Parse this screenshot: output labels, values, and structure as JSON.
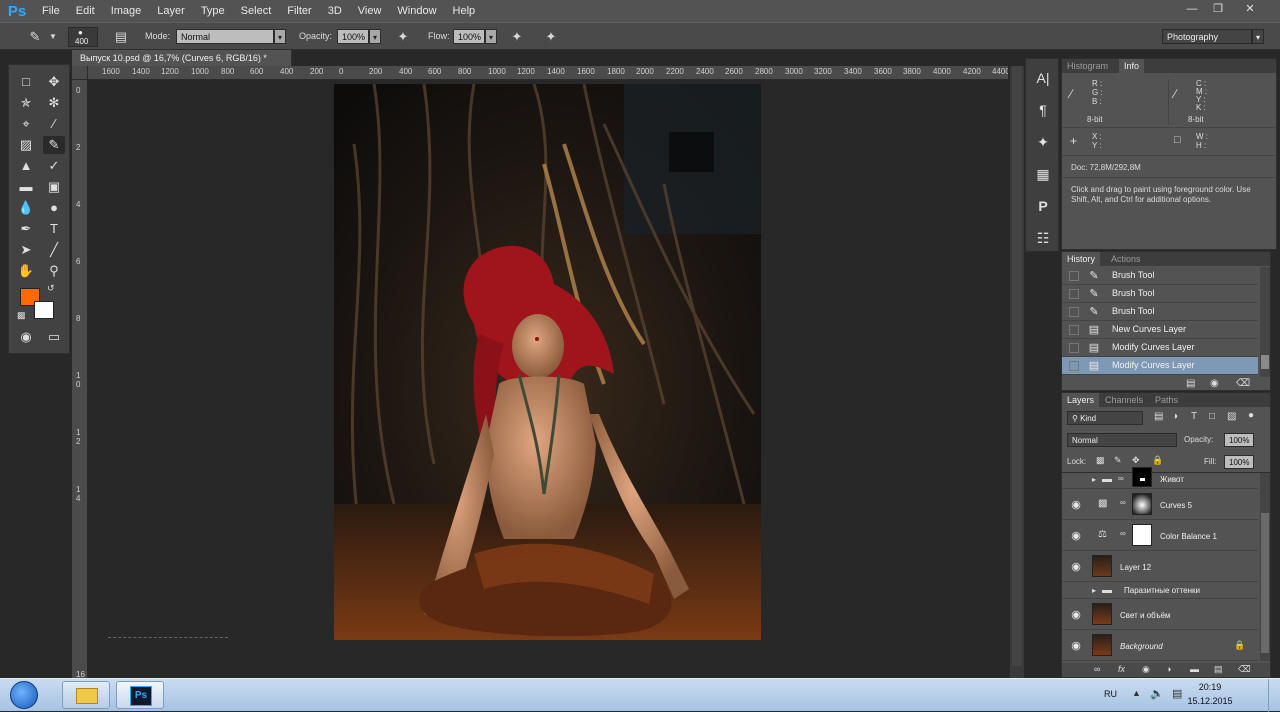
{
  "app": {
    "logo": "Ps",
    "menu": [
      "File",
      "Edit",
      "Image",
      "Layer",
      "Type",
      "Select",
      "Filter",
      "3D",
      "View",
      "Window",
      "Help"
    ]
  },
  "options": {
    "brush_size": "400",
    "mode_label": "Mode:",
    "mode_value": "Normal",
    "opacity_label": "Opacity:",
    "opacity_value": "100%",
    "flow_label": "Flow:",
    "flow_value": "100%",
    "workspace": "Photography"
  },
  "document": {
    "tab_title": "Выпуск 10.psd @ 16,7% (Curves 6, RGB/16) *",
    "ruler_h": [
      "1600",
      "1400",
      "1200",
      "1000",
      "800",
      "600",
      "400",
      "200",
      "0",
      "200",
      "400",
      "600",
      "800",
      "1000",
      "1200",
      "1400",
      "1600",
      "1800",
      "2000",
      "2200",
      "2400",
      "2600",
      "2800",
      "3000",
      "3200",
      "3400",
      "3600",
      "3800",
      "4000",
      "4200",
      "4400"
    ],
    "ruler_v": [
      "0",
      "2",
      "4",
      "6",
      "8",
      "1 0",
      "1 2",
      "1 4"
    ],
    "ruler_v_bottom": "16"
  },
  "info_panel": {
    "tabs": [
      "Histogram",
      "Info"
    ],
    "rgb_labels": [
      "R :",
      "G :",
      "B :"
    ],
    "cmyk_labels": [
      "C :",
      "M :",
      "Y :",
      "K :"
    ],
    "bit_left": "8-bit",
    "bit_right": "8-bit",
    "xy_labels": [
      "X :",
      "Y :"
    ],
    "wh_labels": [
      "W :",
      "H :"
    ],
    "doc_size": "Doc: 72,8M/292,8M",
    "hint": "Click and drag to paint using foreground color. Use Shift, Alt, and Ctrl for additional options."
  },
  "history_panel": {
    "tabs": [
      "History",
      "Actions"
    ],
    "items": [
      {
        "label": "Brush Tool",
        "icon": "brush-icon"
      },
      {
        "label": "Brush Tool",
        "icon": "brush-icon"
      },
      {
        "label": "Brush Tool",
        "icon": "brush-icon"
      },
      {
        "label": "New Curves Layer",
        "icon": "layer-state-icon"
      },
      {
        "label": "Modify Curves Layer",
        "icon": "layer-state-icon"
      },
      {
        "label": "Modify Curves Layer",
        "icon": "layer-state-icon"
      }
    ]
  },
  "layers_panel": {
    "tabs": [
      "Layers",
      "Channels",
      "Paths"
    ],
    "filter_kind": "Kind",
    "blend_mode": "Normal",
    "opacity_label": "Opacity:",
    "opacity_value": "100%",
    "lock_label": "Lock:",
    "fill_label": "Fill:",
    "fill_value": "100%",
    "layers": [
      {
        "name": "Живот",
        "type": "group-with-mask"
      },
      {
        "name": "Curves 5",
        "type": "adjustment"
      },
      {
        "name": "Color Balance 1",
        "type": "adjustment"
      },
      {
        "name": "Layer 12",
        "type": "pixel"
      },
      {
        "name": "Паразитные оттенки",
        "type": "group"
      },
      {
        "name": "Свет и объём",
        "type": "pixel"
      },
      {
        "name": "Background",
        "type": "background"
      }
    ]
  },
  "taskbar": {
    "lang": "RU",
    "time": "20:19",
    "date": "15.12.2015",
    "ps_button": "Ps"
  },
  "colors": {
    "foreground": "#ff6a00",
    "background": "#ffffff",
    "history_selected": "#7e99b5",
    "ui_dark": "#282828",
    "panel": "#535353"
  }
}
